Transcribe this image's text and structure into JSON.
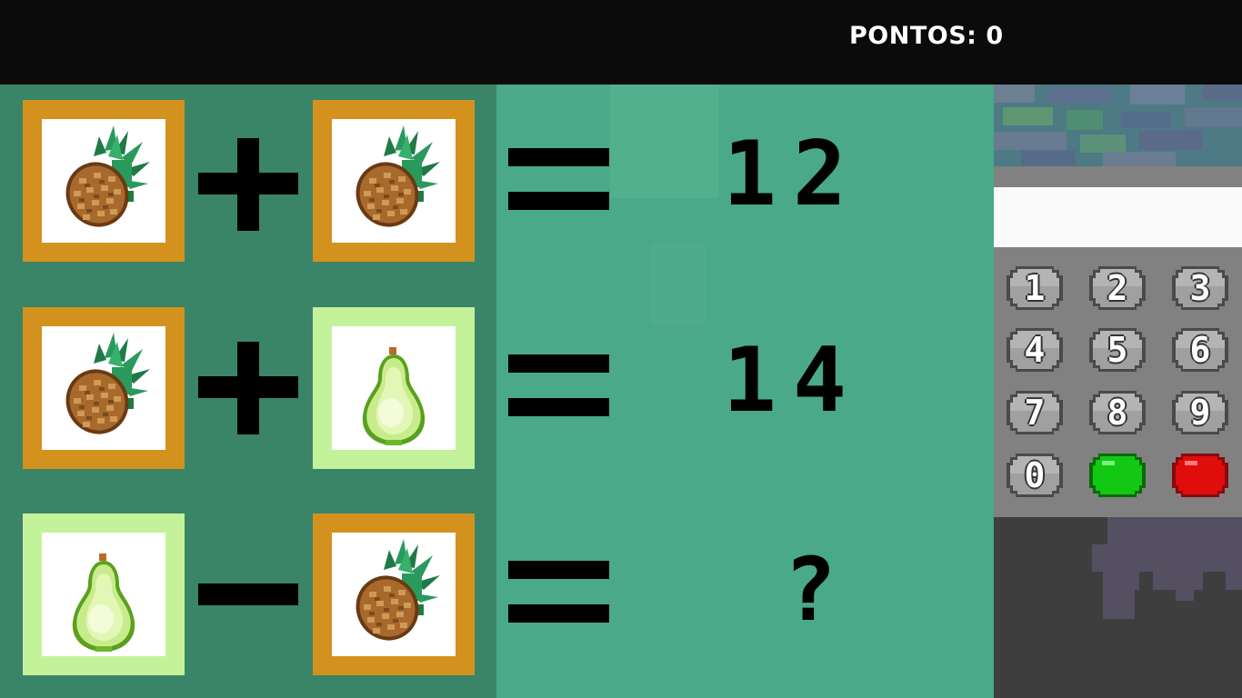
{
  "score": {
    "label": "PONTOS: 0"
  },
  "equations": [
    {
      "left": "pineapple",
      "operator": "+",
      "right": "pineapple",
      "result": "12"
    },
    {
      "left": "pineapple",
      "operator": "+",
      "right": "pear",
      "result": "14"
    },
    {
      "left": "pear",
      "operator": "−",
      "right": "pineapple",
      "result": "?"
    }
  ],
  "display": {
    "value": ""
  },
  "keypad": {
    "keys": [
      "1",
      "2",
      "3",
      "4",
      "5",
      "6",
      "7",
      "8",
      "9",
      "0"
    ],
    "confirm_color": "#12c812",
    "cancel_color": "#e00d0d"
  },
  "colors": {
    "pineapple_frame": "#d3921e",
    "pear_frame": "#c4f29a",
    "top_bar": "#0b0b0b"
  }
}
